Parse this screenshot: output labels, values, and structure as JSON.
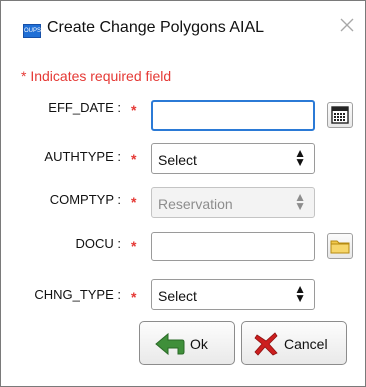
{
  "dialog": {
    "title": "Create Change Polygons AIAL",
    "app_icon_text": "OUPS",
    "required_note": "* Indicates required field"
  },
  "fields": {
    "eff_date": {
      "label": "EFF_DATE :",
      "required_mark": "*",
      "value": ""
    },
    "authtype": {
      "label": "AUTHTYPE :",
      "required_mark": "*",
      "value": "Select"
    },
    "comptyp": {
      "label": "COMPTYP :",
      "required_mark": "*",
      "value": "Reservation",
      "disabled": true
    },
    "docu": {
      "label": "DOCU :",
      "required_mark": "*",
      "value": ""
    },
    "chng_type": {
      "label": "CHNG_TYPE :",
      "required_mark": "*",
      "value": "Select"
    }
  },
  "buttons": {
    "ok_label": "Ok",
    "cancel_label": "Cancel"
  },
  "icons": {
    "calendar": "calendar-icon",
    "folder": "folder-icon",
    "ok": "arrow-left-green-icon",
    "cancel": "red-x-icon",
    "close": "close-icon"
  },
  "colors": {
    "required": "#e53935",
    "focus": "#2b7ad6",
    "folder": "#f2c94c",
    "ok_arrow": "#3f8f3a",
    "cancel_x": "#cc1f1f"
  }
}
